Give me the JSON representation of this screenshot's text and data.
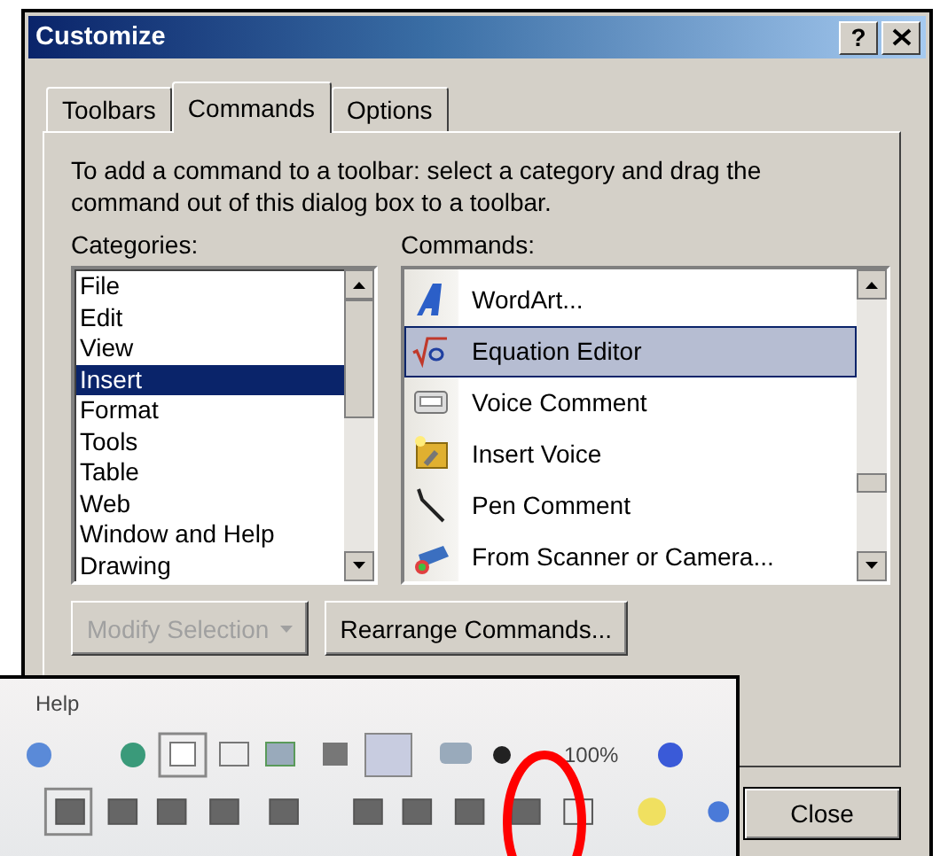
{
  "window": {
    "title": "Customize",
    "help_button": "?"
  },
  "tabs": [
    {
      "label": "Toolbars",
      "selected": false
    },
    {
      "label": "Commands",
      "selected": true
    },
    {
      "label": "Options",
      "selected": false
    }
  ],
  "instructions": "To add a command to a toolbar: select a category and drag the command out of this dialog box to a toolbar.",
  "categories": {
    "label": "Categories:",
    "items": [
      {
        "label": "File",
        "selected": false
      },
      {
        "label": "Edit",
        "selected": false
      },
      {
        "label": "View",
        "selected": false
      },
      {
        "label": "Insert",
        "selected": true
      },
      {
        "label": "Format",
        "selected": false
      },
      {
        "label": "Tools",
        "selected": false
      },
      {
        "label": "Table",
        "selected": false
      },
      {
        "label": "Web",
        "selected": false
      },
      {
        "label": "Window and Help",
        "selected": false
      },
      {
        "label": "Drawing",
        "selected": false
      }
    ]
  },
  "commands": {
    "label": "Commands:",
    "items": [
      {
        "label": "WordArt...",
        "kind": "wordart",
        "selected": false
      },
      {
        "label": "Equation Editor",
        "kind": "equation",
        "selected": true
      },
      {
        "label": "Voice Comment",
        "kind": "tape",
        "selected": false
      },
      {
        "label": "Insert Voice",
        "kind": "voice",
        "selected": false
      },
      {
        "label": "Pen Comment",
        "kind": "pen",
        "selected": false
      },
      {
        "label": "From Scanner or Camera...",
        "kind": "scanner",
        "selected": false
      }
    ]
  },
  "buttons": [
    {
      "label": "Modify Selection",
      "kind": "menu",
      "disabled": true
    },
    {
      "label": "Rearrange Commands...",
      "kind": "plain",
      "disabled": false
    }
  ],
  "close_button": "Close",
  "toolbar_inset": {
    "menu": [
      "Help"
    ],
    "zoom": "100%"
  }
}
